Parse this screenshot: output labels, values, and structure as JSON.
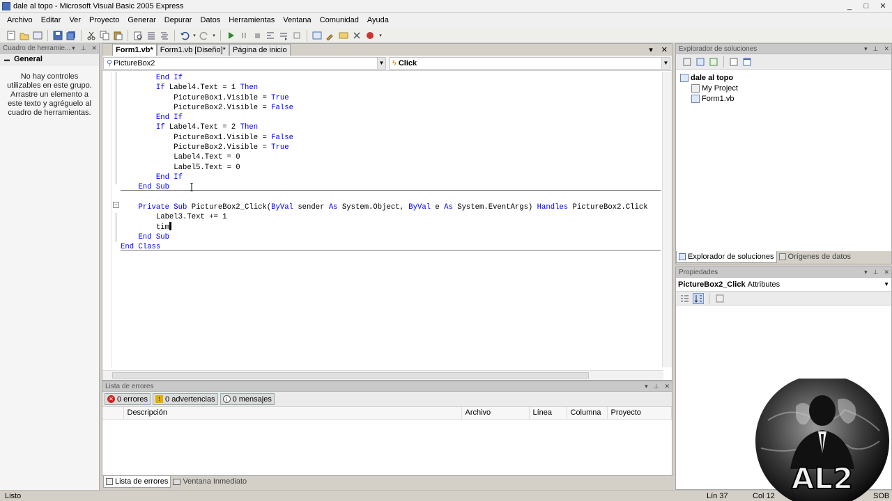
{
  "window": {
    "title": "dale al topo - Microsoft Visual Basic 2005 Express",
    "controls": [
      "_",
      "□",
      "✕"
    ]
  },
  "menu": [
    "Archivo",
    "Editar",
    "Ver",
    "Proyecto",
    "Generar",
    "Depurar",
    "Datos",
    "Herramientas",
    "Ventana",
    "Comunidad",
    "Ayuda"
  ],
  "toolbox": {
    "header": "Cuadro de herramie...",
    "group": "General",
    "empty_message": "No hay controles utilizables en este grupo. Arrastre un elemento a este texto y agréguelo al cuadro de herramientas."
  },
  "editor": {
    "tabs": [
      "Form1.vb*",
      "Form1.vb [Diseño]*",
      "Página de inicio"
    ],
    "object_combo": "PictureBox2",
    "event_combo": "Click",
    "code_lines": [
      {
        "indent": "        ",
        "parts": [
          [
            "kw",
            "End If"
          ]
        ]
      },
      {
        "indent": "        ",
        "parts": [
          [
            "kw",
            "If"
          ],
          [
            "",
            " Label4.Text = 1 "
          ],
          [
            "kw",
            "Then"
          ]
        ]
      },
      {
        "indent": "            ",
        "parts": [
          [
            "",
            "PictureBox1.Visible = "
          ],
          [
            "kw",
            "True"
          ]
        ]
      },
      {
        "indent": "            ",
        "parts": [
          [
            "",
            "PictureBox2.Visible = "
          ],
          [
            "kw",
            "False"
          ]
        ]
      },
      {
        "indent": "        ",
        "parts": [
          [
            "kw",
            "End If"
          ]
        ]
      },
      {
        "indent": "        ",
        "parts": [
          [
            "kw",
            "If"
          ],
          [
            "",
            " Label4.Text = 2 "
          ],
          [
            "kw",
            "Then"
          ]
        ]
      },
      {
        "indent": "            ",
        "parts": [
          [
            "",
            "PictureBox1.Visible = "
          ],
          [
            "kw",
            "False"
          ]
        ]
      },
      {
        "indent": "            ",
        "parts": [
          [
            "",
            "PictureBox2.Visible = "
          ],
          [
            "kw",
            "True"
          ]
        ]
      },
      {
        "indent": "            ",
        "parts": [
          [
            "",
            "Label4.Text = 0"
          ]
        ]
      },
      {
        "indent": "            ",
        "parts": [
          [
            "",
            "Label5.Text = 0"
          ]
        ]
      },
      {
        "indent": "        ",
        "parts": [
          [
            "kw",
            "End If"
          ]
        ]
      },
      {
        "indent": "    ",
        "parts": [
          [
            "kw",
            "End Sub"
          ]
        ]
      },
      {
        "indent": "",
        "parts": [
          [
            "",
            ""
          ]
        ]
      },
      {
        "indent": "    ",
        "parts": [
          [
            "kw",
            "Private Sub"
          ],
          [
            "",
            " PictureBox2_Click("
          ],
          [
            "kw",
            "ByVal"
          ],
          [
            "",
            " sender "
          ],
          [
            "kw",
            "As"
          ],
          [
            "",
            " System.Object, "
          ],
          [
            "kw",
            "ByVal"
          ],
          [
            "",
            " e "
          ],
          [
            "kw",
            "As"
          ],
          [
            "",
            " System.EventArgs) "
          ],
          [
            "kw",
            "Handles"
          ],
          [
            "",
            " PictureBox2.Click"
          ]
        ]
      },
      {
        "indent": "        ",
        "parts": [
          [
            "",
            "Label3.Text += 1"
          ]
        ]
      },
      {
        "indent": "        ",
        "parts": [
          [
            "",
            "tim"
          ]
        ]
      },
      {
        "indent": "    ",
        "parts": [
          [
            "kw",
            "End Sub"
          ]
        ]
      },
      {
        "indent": "",
        "parts": [
          [
            "kw",
            "End Class"
          ]
        ]
      }
    ]
  },
  "errors": {
    "header": "Lista de errores",
    "filters": [
      "0 errores",
      "0 advertencias",
      "0 mensajes"
    ],
    "columns": [
      "",
      "Descripción",
      "Archivo",
      "Línea",
      "Columna",
      "Proyecto"
    ]
  },
  "bottom_tabs": [
    "Lista de errores",
    "Ventana Inmediato"
  ],
  "solution_explorer": {
    "header": "Explorador de soluciones",
    "root": "dale al topo",
    "items": [
      "My Project",
      "Form1.vb"
    ],
    "tabs": [
      "Explorador de soluciones",
      "Orígenes de datos"
    ]
  },
  "properties": {
    "header": "Propiedades",
    "object_name": "PictureBox2_Click",
    "object_type": "Attributes"
  },
  "status": {
    "ready": "Listo",
    "line": "Lín 37",
    "col": "Col 12",
    "mode": "SOB"
  },
  "watermark_text": "AL2",
  "colors": {
    "keyword": "#0000ff",
    "chrome": "#d4d0c8"
  }
}
